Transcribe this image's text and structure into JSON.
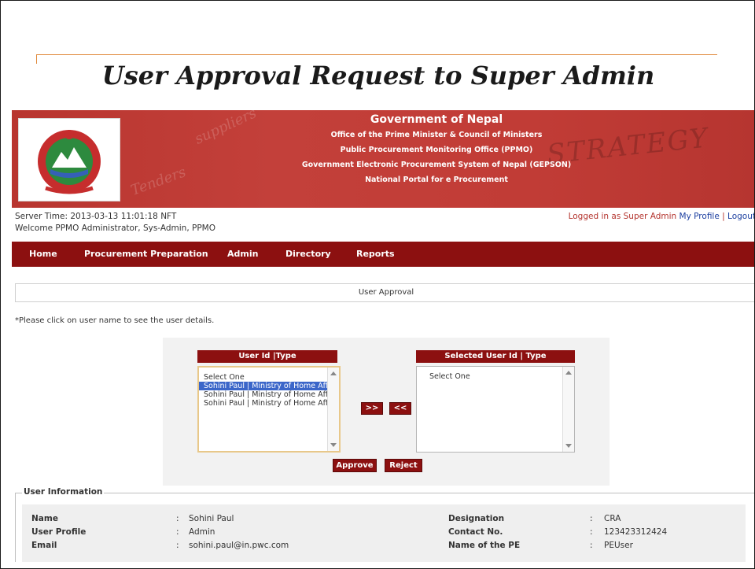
{
  "slide": {
    "title": "User Approval Request to Super Admin"
  },
  "banner": {
    "lines": [
      "Government of Nepal",
      "Office of the Prime Minister & Council of Ministers",
      "Public Procurement Monitoring Office (PPMO)",
      "Government Electronic Procurement System of Nepal (GEPSON)",
      "National Portal for e Procurement"
    ],
    "watermarks": [
      "suppliers",
      "Tenders",
      "STRATEGY"
    ]
  },
  "header": {
    "server_time": "Server Time: 2013-03-13 11:01:18 NFT",
    "welcome": "Welcome PPMO Administrator, Sys-Admin, PPMO",
    "logged_in": "Logged in as Super Admin",
    "my_profile": "My Profile",
    "separator": "|",
    "logout": "Logout"
  },
  "nav": {
    "items": [
      "Home",
      "Procurement Preparation",
      "Admin",
      "Directory",
      "Reports"
    ]
  },
  "page": {
    "section_title": "User Approval",
    "note": "*Please click on user name to see the user details."
  },
  "lists": {
    "left_header": "User Id |Type",
    "left_options": [
      "Select One",
      "Sohini Paul | Ministry of Home Affair",
      "Sohini Paul | Ministry of Home Affair",
      "Sohini Paul | Ministry of Home Affair"
    ],
    "selected_index": 1,
    "right_header": "Selected User Id | Type",
    "right_options": [
      "Select One"
    ]
  },
  "buttons": {
    "move_right": ">>",
    "move_left": "<<",
    "approve": "Approve",
    "reject": "Reject"
  },
  "user_info": {
    "legend": "User Information",
    "left": [
      {
        "label": "Name",
        "value": "Sohini Paul"
      },
      {
        "label": "User Profile",
        "value": "Admin"
      },
      {
        "label": "Email",
        "value": "sohini.paul@in.pwc.com"
      }
    ],
    "right": [
      {
        "label": "Designation",
        "value": "CRA"
      },
      {
        "label": "Contact No.",
        "value": "123423312424"
      },
      {
        "label": "Name of the PE",
        "value": "PEUser"
      }
    ]
  },
  "colors": {
    "accent": "#8c1010",
    "banner": "#c13c36",
    "link": "#1c3fa0",
    "selection": "#3b66c9"
  }
}
